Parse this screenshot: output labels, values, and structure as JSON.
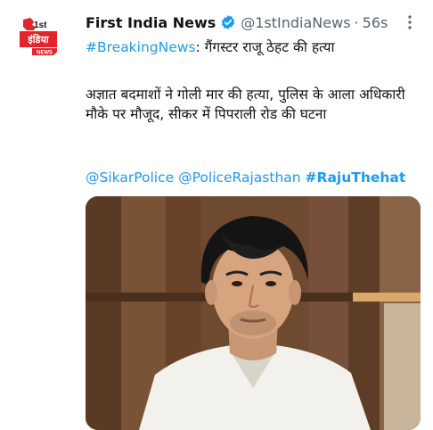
{
  "tweet": {
    "display_name": "First India News",
    "handle": "@1stIndiaNews",
    "separator": "·",
    "time": "56s",
    "hashtag_breaking": "#BreakingNews",
    "headline": ": गैंगस्टर राजू ठेहट की हत्या",
    "body": "अज्ञात बदमाशों ने गोली मार की हत्या, पुलिस के आला अधिकारी मौके पर मौजूद, सीकर में पिपराली रोड की घटना",
    "mention_1": "@SikarPolice",
    "mention_2": "@PoliceRajasthan",
    "hashtag_2": "#RajuThehat"
  },
  "avatar": {
    "logo_text_1st": "1st",
    "logo_text_india": "इंडिया",
    "logo_text_news": "NEWS"
  },
  "icons": {
    "verified": "verified-badge-icon",
    "more": "more-options-icon"
  },
  "colors": {
    "accent": "#1d9bf0",
    "brand_red": "#e5232b",
    "text": "#0f1419",
    "muted": "#536471"
  }
}
